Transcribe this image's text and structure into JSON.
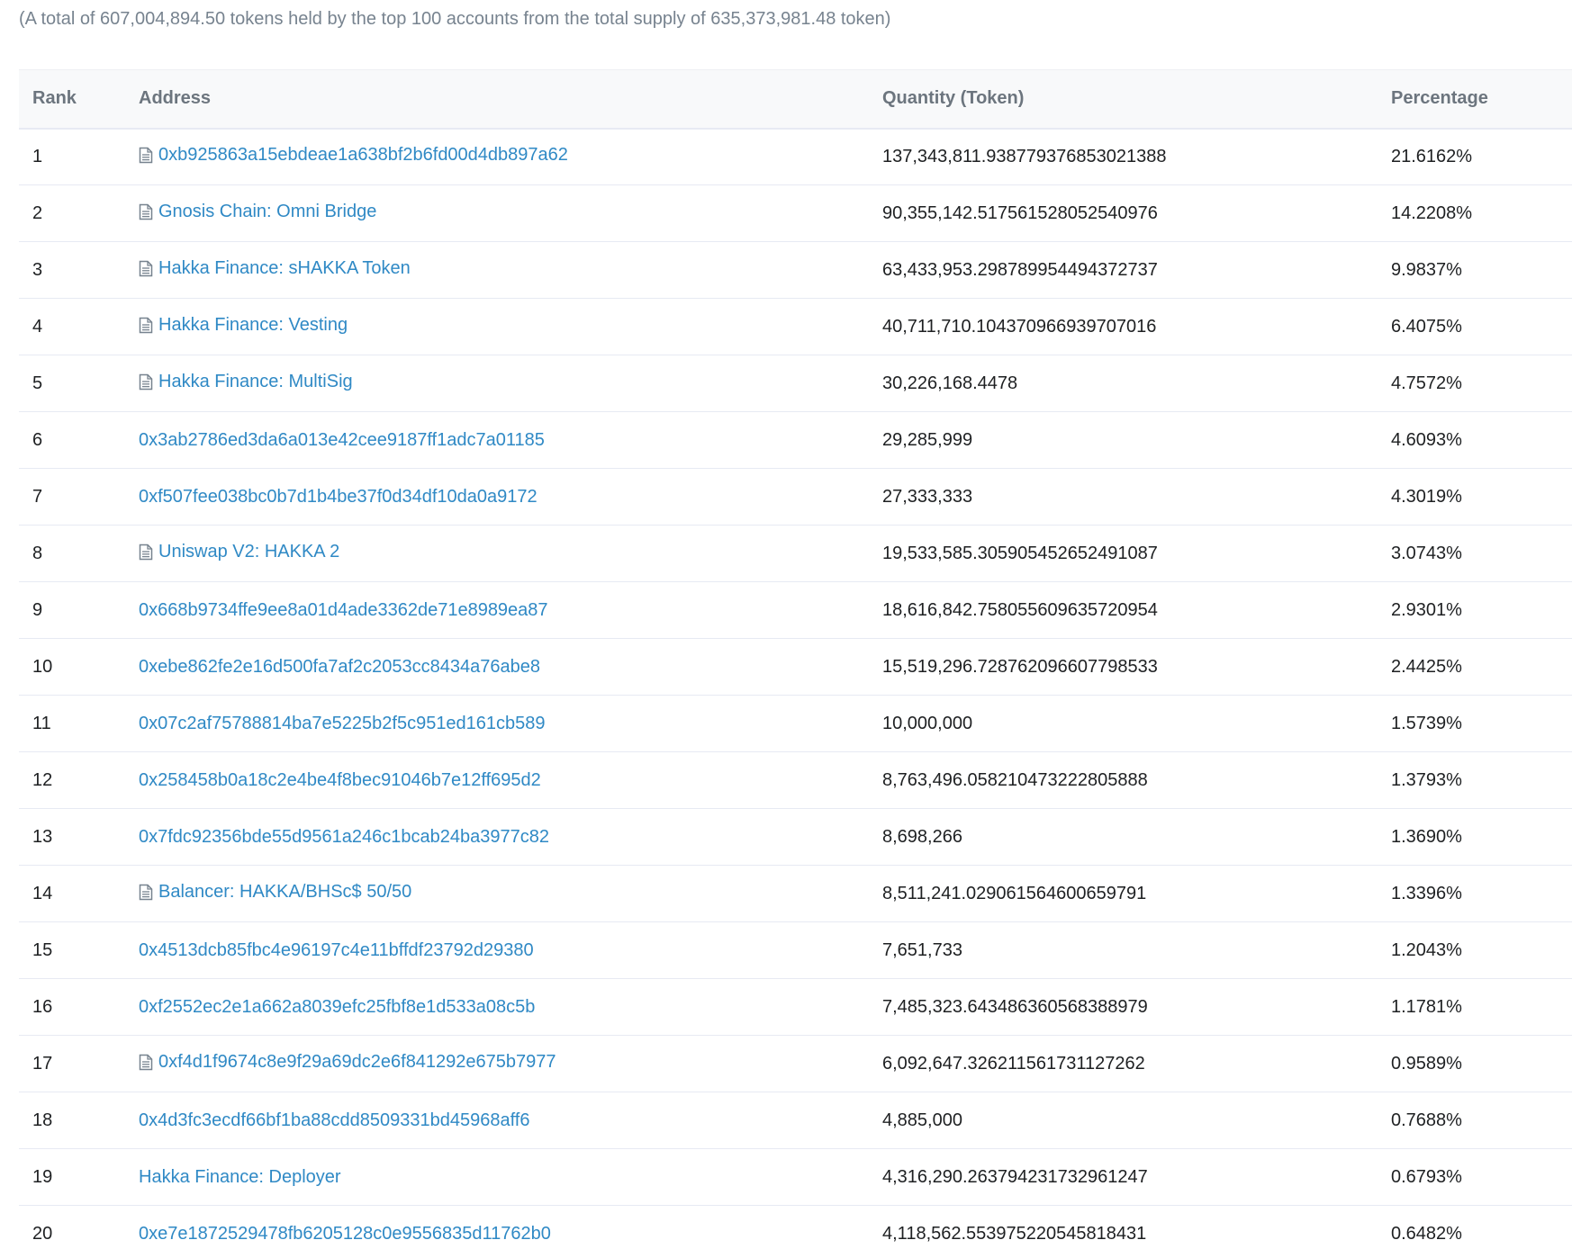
{
  "summary": "(A total of 607,004,894.50 tokens held by the top 100 accounts from the total supply of 635,373,981.48 token)",
  "table": {
    "headers": {
      "rank": "Rank",
      "address": "Address",
      "quantity": "Quantity (Token)",
      "percentage": "Percentage"
    },
    "rows": [
      {
        "rank": "1",
        "address": "0xb925863a15ebdeae1a638bf2b6fd00d4db897a62",
        "contract": true,
        "quantity": "137,343,811.938779376853021388",
        "percentage": "21.6162%"
      },
      {
        "rank": "2",
        "address": "Gnosis Chain: Omni Bridge",
        "contract": true,
        "quantity": "90,355,142.517561528052540976",
        "percentage": "14.2208%"
      },
      {
        "rank": "3",
        "address": "Hakka Finance: sHAKKA Token",
        "contract": true,
        "quantity": "63,433,953.298789954494372737",
        "percentage": "9.9837%"
      },
      {
        "rank": "4",
        "address": "Hakka Finance: Vesting",
        "contract": true,
        "quantity": "40,711,710.104370966939707016",
        "percentage": "6.4075%"
      },
      {
        "rank": "5",
        "address": "Hakka Finance: MultiSig",
        "contract": true,
        "quantity": "30,226,168.4478",
        "percentage": "4.7572%"
      },
      {
        "rank": "6",
        "address": "0x3ab2786ed3da6a013e42cee9187ff1adc7a01185",
        "contract": false,
        "quantity": "29,285,999",
        "percentage": "4.6093%"
      },
      {
        "rank": "7",
        "address": "0xf507fee038bc0b7d1b4be37f0d34df10da0a9172",
        "contract": false,
        "quantity": "27,333,333",
        "percentage": "4.3019%"
      },
      {
        "rank": "8",
        "address": "Uniswap V2: HAKKA 2",
        "contract": true,
        "quantity": "19,533,585.305905452652491087",
        "percentage": "3.0743%"
      },
      {
        "rank": "9",
        "address": "0x668b9734ffe9ee8a01d4ade3362de71e8989ea87",
        "contract": false,
        "quantity": "18,616,842.758055609635720954",
        "percentage": "2.9301%"
      },
      {
        "rank": "10",
        "address": "0xebe862fe2e16d500fa7af2c2053cc8434a76abe8",
        "contract": false,
        "quantity": "15,519,296.728762096607798533",
        "percentage": "2.4425%"
      },
      {
        "rank": "11",
        "address": "0x07c2af75788814ba7e5225b2f5c951ed161cb589",
        "contract": false,
        "quantity": "10,000,000",
        "percentage": "1.5739%"
      },
      {
        "rank": "12",
        "address": "0x258458b0a18c2e4be4f8bec91046b7e12ff695d2",
        "contract": false,
        "quantity": "8,763,496.058210473222805888",
        "percentage": "1.3793%"
      },
      {
        "rank": "13",
        "address": "0x7fdc92356bde55d9561a246c1bcab24ba3977c82",
        "contract": false,
        "quantity": "8,698,266",
        "percentage": "1.3690%"
      },
      {
        "rank": "14",
        "address": "Balancer: HAKKA/BHSc$ 50/50",
        "contract": true,
        "quantity": "8,511,241.029061564600659791",
        "percentage": "1.3396%"
      },
      {
        "rank": "15",
        "address": "0x4513dcb85fbc4e96197c4e11bffdf23792d29380",
        "contract": false,
        "quantity": "7,651,733",
        "percentage": "1.2043%"
      },
      {
        "rank": "16",
        "address": "0xf2552ec2e1a662a8039efc25fbf8e1d533a08c5b",
        "contract": false,
        "quantity": "7,485,323.643486360568388979",
        "percentage": "1.1781%"
      },
      {
        "rank": "17",
        "address": "0xf4d1f9674c8e9f29a69dc2e6f841292e675b7977",
        "contract": true,
        "quantity": "6,092,647.326211561731127262",
        "percentage": "0.9589%"
      },
      {
        "rank": "18",
        "address": "0x4d3fc3ecdf66bf1ba88cdd8509331bd45968aff6",
        "contract": false,
        "quantity": "4,885,000",
        "percentage": "0.7688%"
      },
      {
        "rank": "19",
        "address": "Hakka Finance: Deployer",
        "contract": false,
        "quantity": "4,316,290.263794231732961247",
        "percentage": "0.6793%"
      },
      {
        "rank": "20",
        "address": "0xe7e1872529478fb6205128c0e9556835d11762b0",
        "contract": false,
        "quantity": "4,118,562.553975220545818431",
        "percentage": "0.6482%"
      }
    ]
  },
  "colors": {
    "link": "#2f89c5",
    "muted": "#77838f",
    "border": "#e7eaf3"
  },
  "icons": {
    "contract": "file-text-icon"
  }
}
